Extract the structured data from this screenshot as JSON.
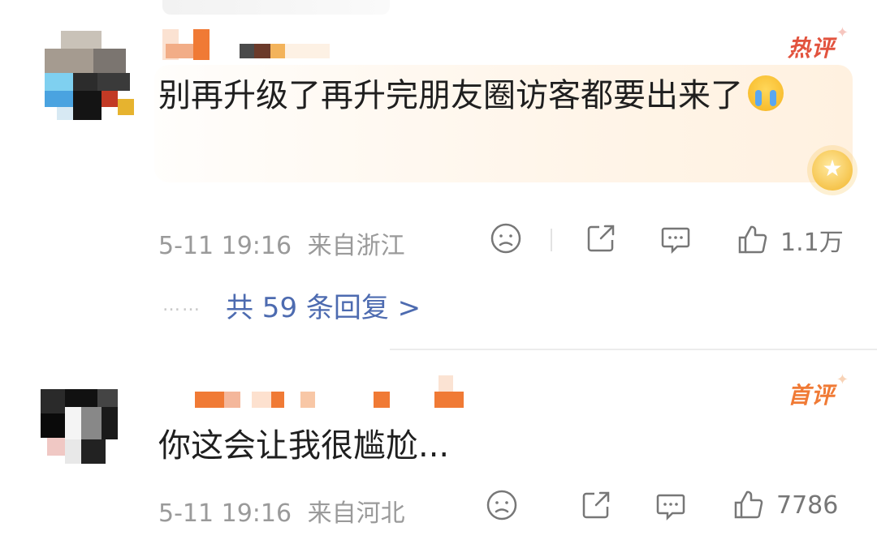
{
  "comments": [
    {
      "badge": "热评",
      "text": "别再升级了再升完朋友圈访客都要出来了",
      "emoji_icon": "crying-face-icon",
      "time": "5-11 19:16",
      "location": "来自浙江",
      "likes": "1.1万",
      "replies_label": "共 59 条回复 >",
      "replies_dots": "……",
      "highlight_color": "#fff3e6"
    },
    {
      "badge": "首评",
      "text": "你这会让我很尴尬...",
      "time": "5-11 19:16",
      "location": "来自河北",
      "likes": "7786"
    }
  ],
  "icons": {
    "dislike": "sad-face-icon",
    "share": "share-icon",
    "comment": "comment-icon",
    "like": "thumbs-up-icon",
    "medal": "hot-medal-icon"
  },
  "colors": {
    "hot_badge": "#e2533e",
    "first_badge": "#f07a35",
    "link": "#4d6bb0",
    "meta": "#9a9a9a"
  }
}
